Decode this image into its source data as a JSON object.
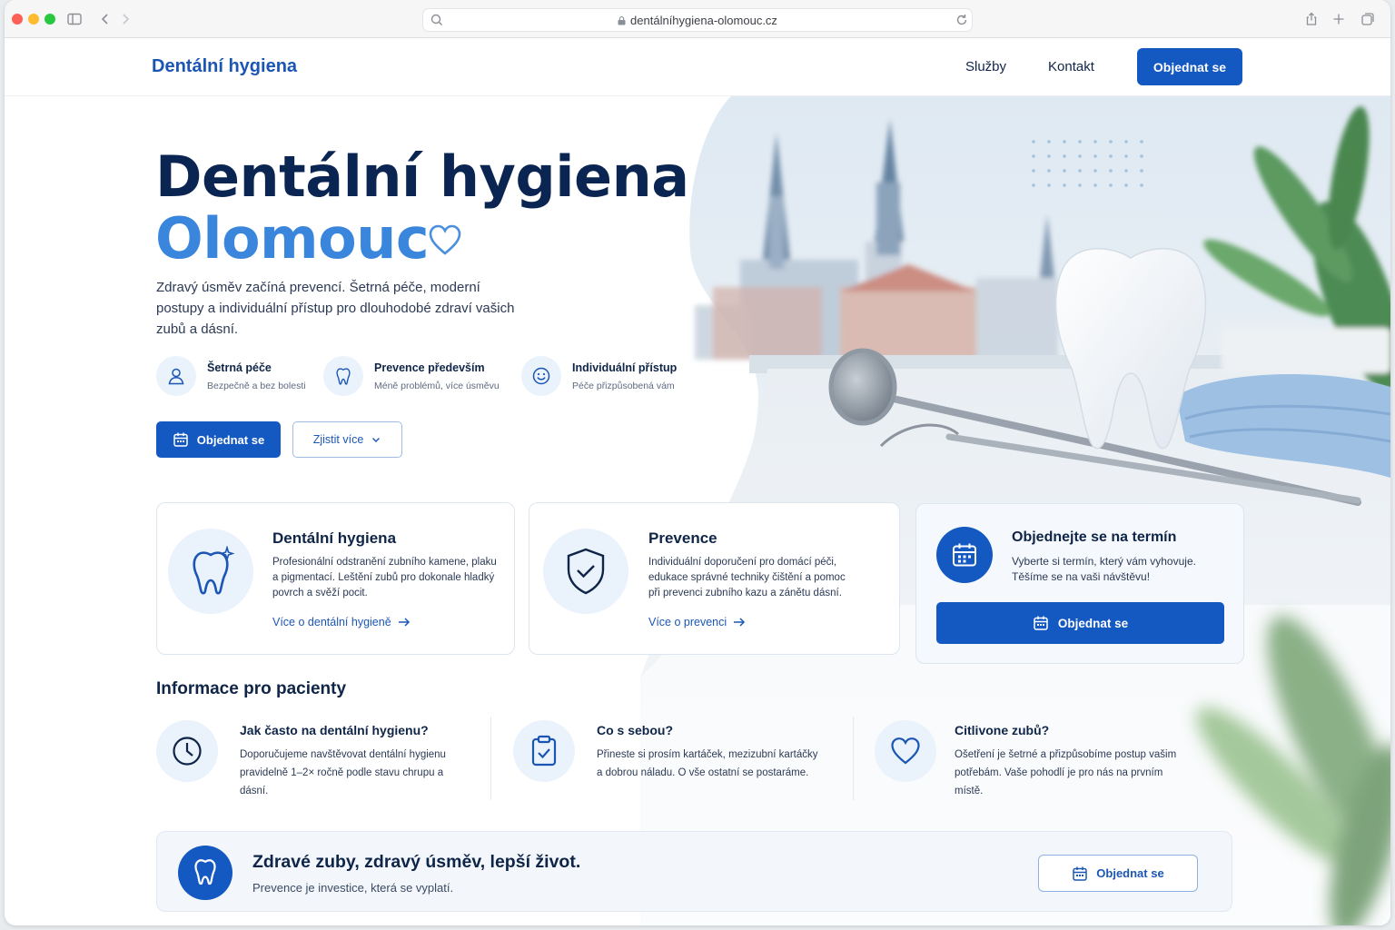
{
  "browser": {
    "url": "dentálníhygiena-olomouc.cz"
  },
  "header": {
    "logo": "Dentální hygiena",
    "nav": [
      "Služby",
      "Kontakt"
    ],
    "cta": "Objednat se"
  },
  "hero": {
    "title_line1": "Dentální hygiena",
    "title_line2": "Olomouc",
    "subtitle": "Zdravý úsměv začíná prevencí. Šetrná péče, moderní postupy a individuální přístup pro dlouhodobé zdraví vašich zubů a dásní.",
    "features": [
      {
        "title": "Šetrná péče",
        "desc": "Bezpečně a bez bolesti",
        "icon": "person-icon"
      },
      {
        "title": "Prevence především",
        "desc": "Méně problémů, více úsměvu",
        "icon": "tooth-icon"
      },
      {
        "title": "Individuální přístup",
        "desc": "Péče přizpůsobená vám",
        "icon": "smile-icon"
      }
    ],
    "primary_button": "Objednat se",
    "secondary_button": "Zjistit více"
  },
  "cards": [
    {
      "title": "Dentální hygiena",
      "desc": "Profesionální odstranění zubního kamene, plaku a pigmentací. Leštění zubů pro dokonale hladký povrch a svěží pocit.",
      "link": "Více o dentální hygieně"
    },
    {
      "title": "Prevence",
      "desc": "Individuální doporučení pro domácí péči, edukace správné techniky čištění a pomoc při prevenci zubního kazu a zánětu dásní.",
      "link": "Více o prevenci"
    }
  ],
  "booking": {
    "title": "Objednejte se na termín",
    "desc": "Vyberte si termín, který vám vyhovuje. Těšíme se na vaši návštěvu!",
    "button": "Objednat se"
  },
  "patient_info": {
    "heading": "Informace pro pacienty",
    "items": [
      {
        "title": "Jak často na dentální hygienu?",
        "desc": "Doporučujeme navštěvovat dentální hygienu pravidelně 1–2× ročně podle stavu chrupu a dásní.",
        "icon": "clock-icon"
      },
      {
        "title": "Co s sebou?",
        "desc": "Přineste si prosím kartáček, mezizubní kartáčky a dobrou náladu. O vše ostatní se postaráme.",
        "icon": "clipboard-check-icon"
      },
      {
        "title": "Citlivone zubů?",
        "desc": "Ošetření je šetrné a přizpůsobíme postup vašim potřebám. Vaše pohodlí je pro nás na prvním místě.",
        "icon": "heart-icon"
      }
    ]
  },
  "banner": {
    "title": "Zdravé zuby, zdravý úsměv, lepší život.",
    "subtitle": "Prevence je investice, která se vyplatí.",
    "button": "Objednat se"
  },
  "colors": {
    "primary": "#1458c1",
    "navy": "#0b2552",
    "accent_blue": "#3b86dd",
    "icon_bg": "#eaf2fc"
  }
}
